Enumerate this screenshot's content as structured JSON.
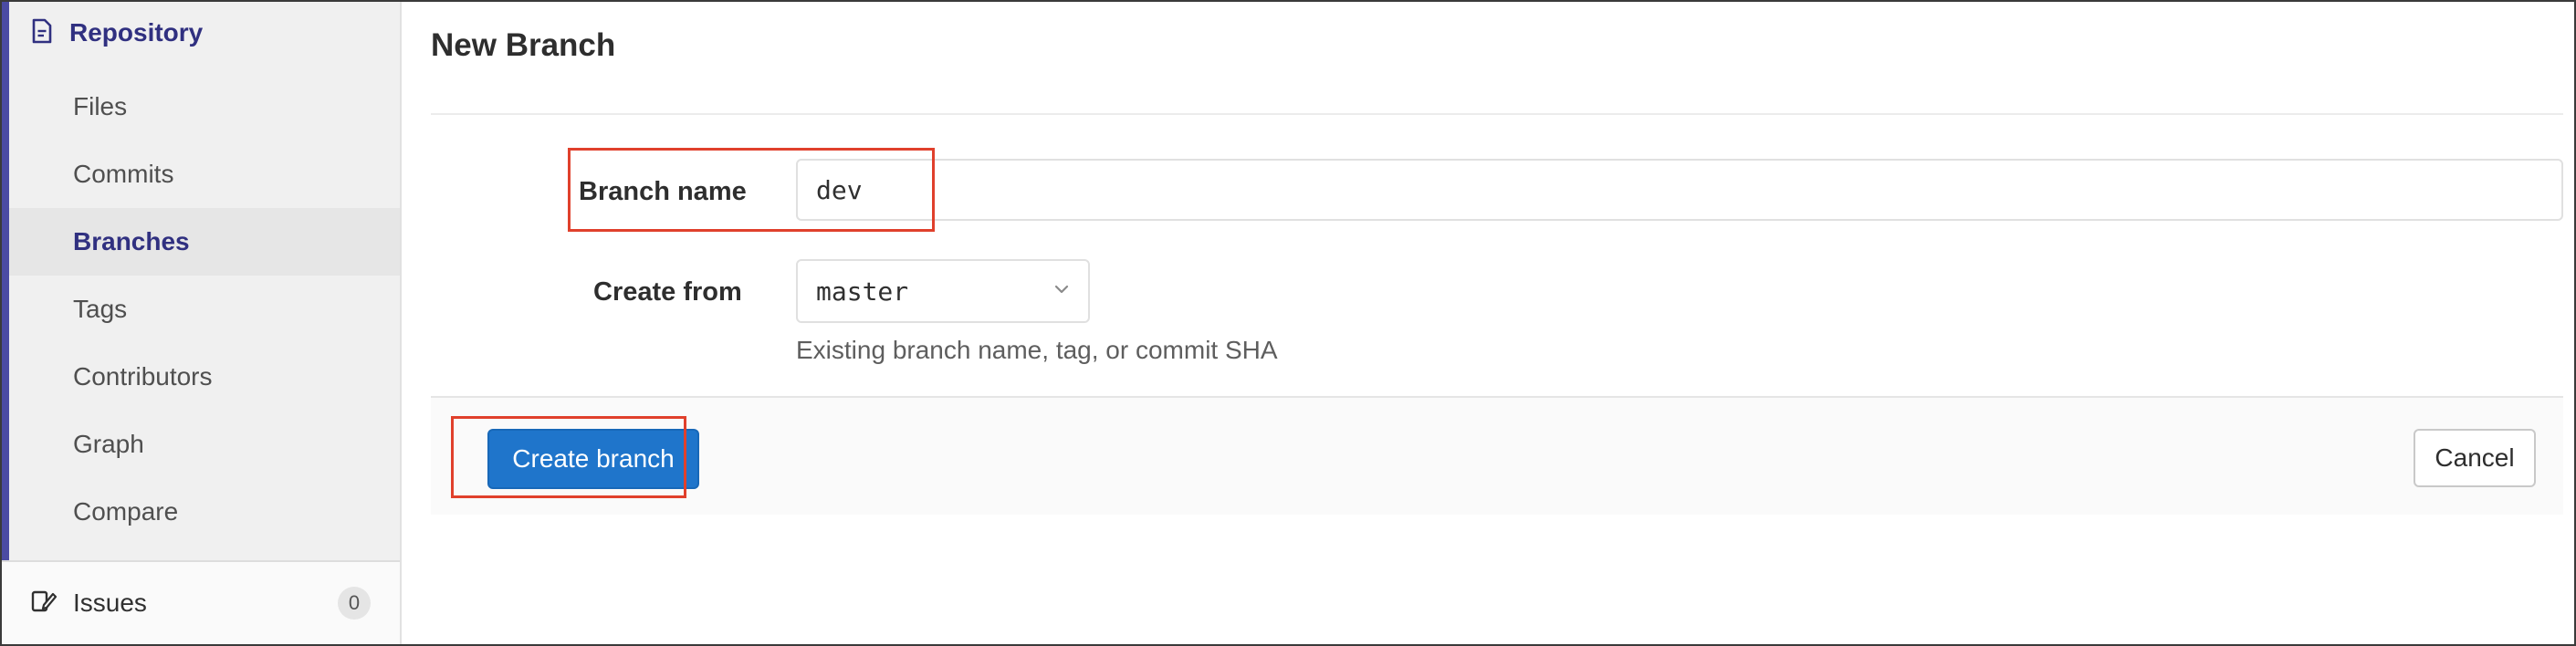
{
  "sidebar": {
    "section": {
      "label": "Repository",
      "icon": "document-icon"
    },
    "items": [
      {
        "label": "Files",
        "active": false
      },
      {
        "label": "Commits",
        "active": false
      },
      {
        "label": "Branches",
        "active": true
      },
      {
        "label": "Tags",
        "active": false
      },
      {
        "label": "Contributors",
        "active": false
      },
      {
        "label": "Graph",
        "active": false
      },
      {
        "label": "Compare",
        "active": false
      }
    ],
    "issues": {
      "label": "Issues",
      "count": "0",
      "icon": "issues-icon"
    },
    "accent_color": "#4b4ba3"
  },
  "main": {
    "title": "New Branch",
    "form": {
      "branch_name_label": "Branch name",
      "branch_name_value": "dev",
      "create_from_label": "Create from",
      "create_from_value": "master",
      "create_from_help": "Existing branch name, tag, or commit SHA"
    },
    "actions": {
      "create_label": "Create branch",
      "cancel_label": "Cancel"
    },
    "colors": {
      "primary": "#1f75cb",
      "highlight": "#e0402c"
    }
  }
}
